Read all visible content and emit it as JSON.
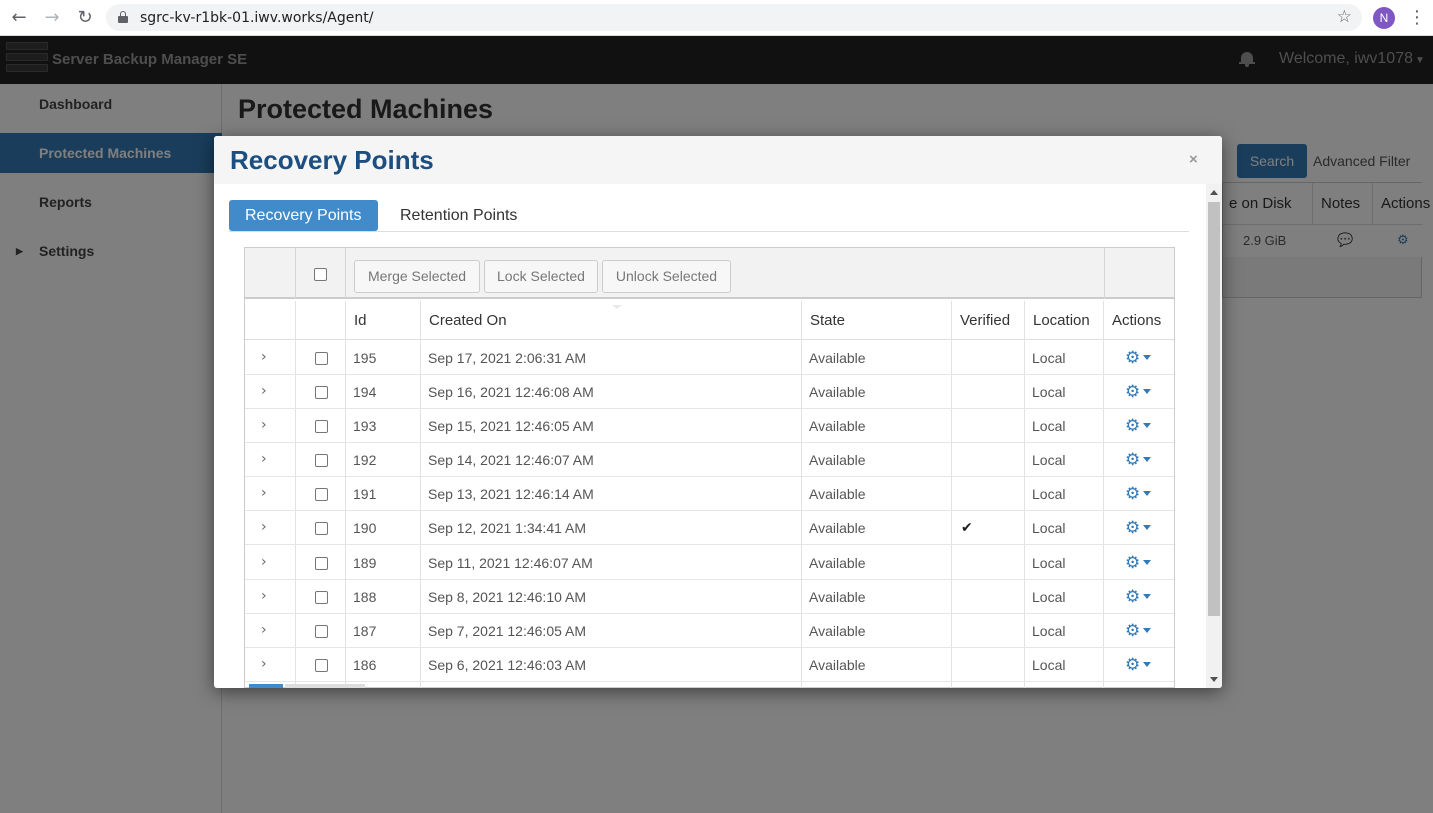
{
  "browser": {
    "url": "sgrc-kv-r1bk-01.iwv.works/Agent/",
    "profile_initial": "N"
  },
  "app": {
    "brand": "Server Backup Manager SE",
    "welcome": "Welcome, iwv1078"
  },
  "sidebar": {
    "items": [
      {
        "label": "Dashboard"
      },
      {
        "label": "Protected Machines"
      },
      {
        "label": "Reports"
      },
      {
        "label": "Settings"
      }
    ]
  },
  "main": {
    "title": "Protected Machines",
    "search_label": "Search",
    "advanced_filter_label": "Advanced Filter",
    "table": {
      "headers": [
        "e on Disk",
        "Notes",
        "Actions"
      ],
      "size_value": "2.9 GiB"
    }
  },
  "modal": {
    "title": "Recovery Points",
    "close": "×",
    "tabs": [
      {
        "label": "Recovery Points",
        "active": true
      },
      {
        "label": "Retention Points",
        "active": false
      }
    ],
    "toolbar": {
      "merge_label": "Merge Selected",
      "lock_label": "Lock Selected",
      "unlock_label": "Unlock Selected"
    },
    "columns": [
      "Id",
      "Created On",
      "State",
      "Verified",
      "Location",
      "Actions"
    ],
    "rows": [
      {
        "id": "195",
        "created": "Sep 17, 2021 2:06:31 AM",
        "state": "Available",
        "verified": "",
        "location": "Local"
      },
      {
        "id": "194",
        "created": "Sep 16, 2021 12:46:08 AM",
        "state": "Available",
        "verified": "",
        "location": "Local"
      },
      {
        "id": "193",
        "created": "Sep 15, 2021 12:46:05 AM",
        "state": "Available",
        "verified": "",
        "location": "Local"
      },
      {
        "id": "192",
        "created": "Sep 14, 2021 12:46:07 AM",
        "state": "Available",
        "verified": "",
        "location": "Local"
      },
      {
        "id": "191",
        "created": "Sep 13, 2021 12:46:14 AM",
        "state": "Available",
        "verified": "",
        "location": "Local"
      },
      {
        "id": "190",
        "created": "Sep 12, 2021 1:34:41 AM",
        "state": "Available",
        "verified": "✔",
        "location": "Local"
      },
      {
        "id": "189",
        "created": "Sep 11, 2021 12:46:07 AM",
        "state": "Available",
        "verified": "",
        "location": "Local"
      },
      {
        "id": "188",
        "created": "Sep 8, 2021 12:46:10 AM",
        "state": "Available",
        "verified": "",
        "location": "Local"
      },
      {
        "id": "187",
        "created": "Sep 7, 2021 12:46:05 AM",
        "state": "Available",
        "verified": "",
        "location": "Local"
      },
      {
        "id": "186",
        "created": "Sep 6, 2021 12:46:03 AM",
        "state": "Available",
        "verified": "",
        "location": "Local"
      }
    ]
  },
  "icons": {
    "back": "back-arrow-icon",
    "forward": "forward-arrow-icon",
    "reload": "reload-icon",
    "lock": "lock-icon",
    "star": "star-icon",
    "bell": "bell-icon",
    "gear": "gear-icon",
    "expand": "chevron-right-icon"
  },
  "colors": {
    "accent": "#337ab7",
    "tab_active": "#428bca",
    "modal_title": "#1c4e80",
    "header_bg": "#222222"
  }
}
